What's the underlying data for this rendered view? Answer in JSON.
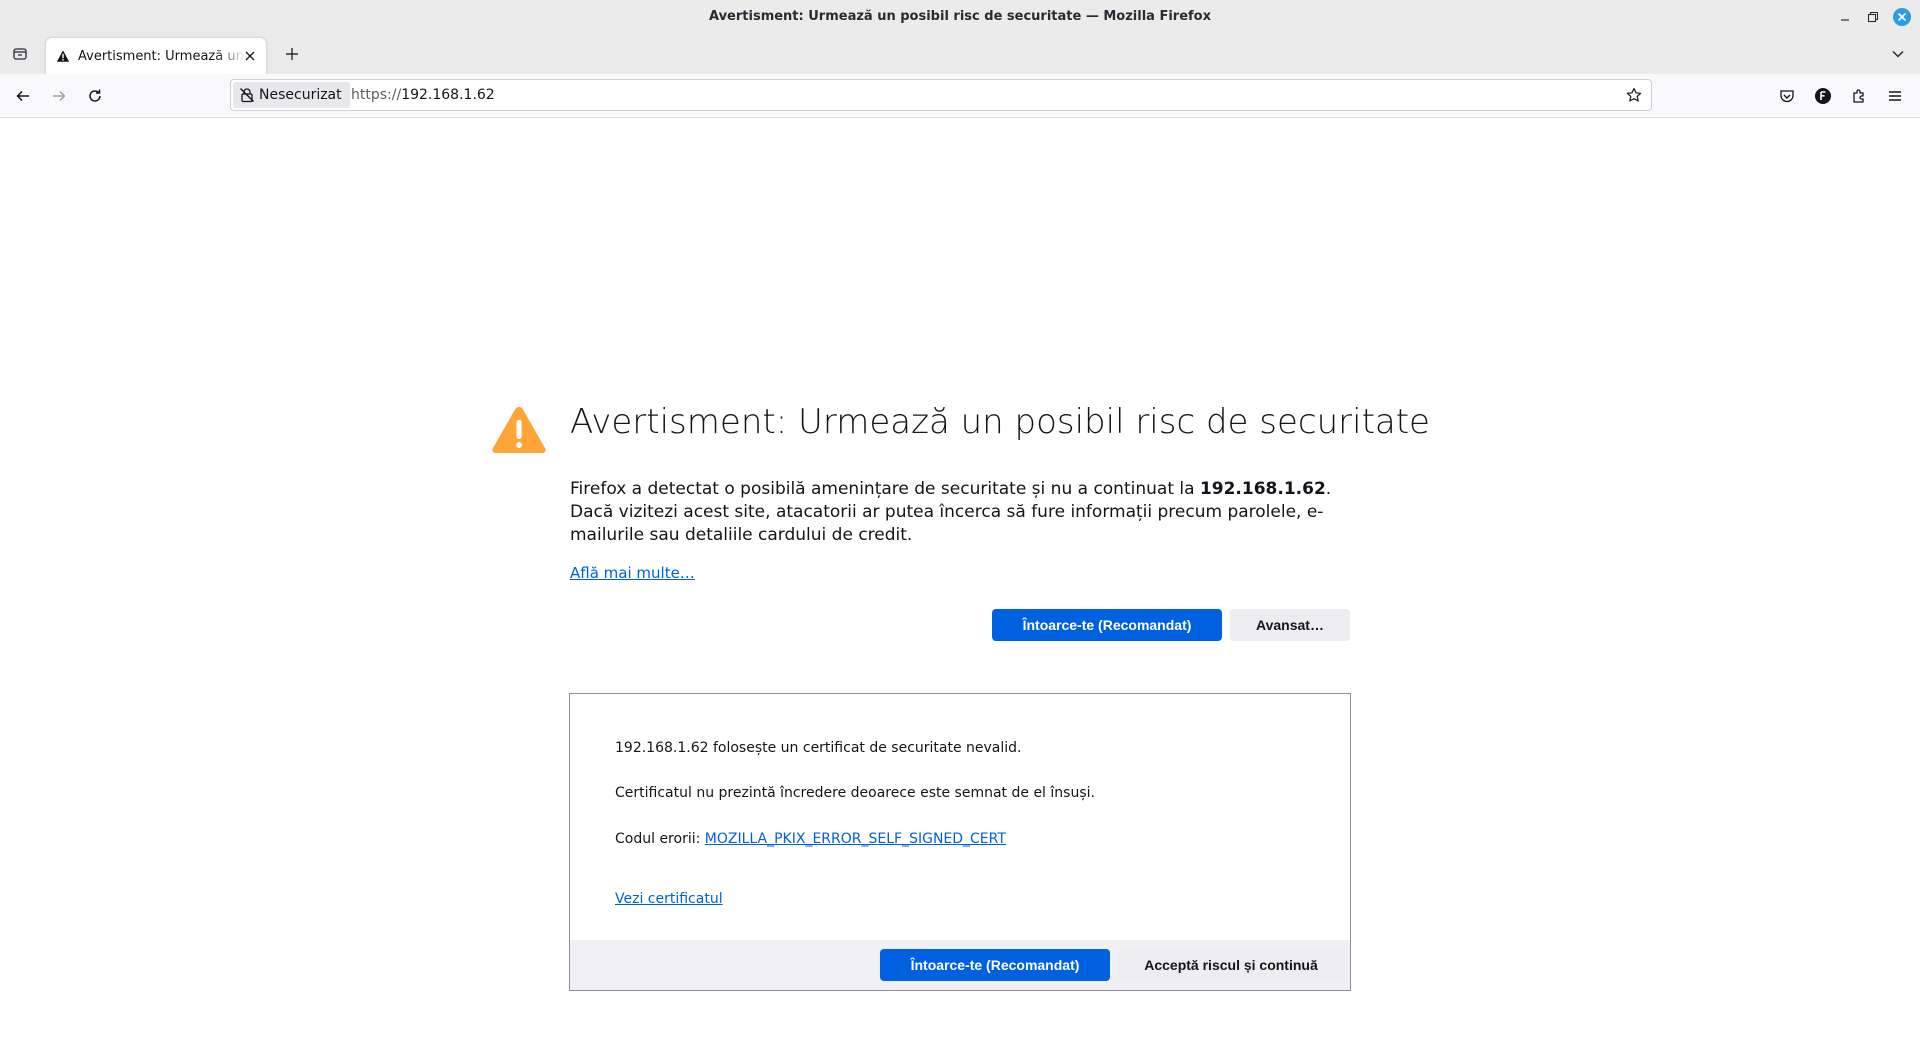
{
  "window": {
    "title": "Avertisment: Urmează un posibil risc de securitate — Mozilla Firefox",
    "controls": [
      "minimize-icon",
      "restore-icon",
      "close-icon"
    ],
    "close_color": "#2a9ee4"
  },
  "tabs": [
    {
      "title": "Avertisment: Urmează un posibil risc de securitate",
      "icon": "warning-icon",
      "active": true
    }
  ],
  "navbar": {
    "identity_label": "Nesecurizat",
    "url_scheme": "https://",
    "url_host": "192.168.1.62",
    "icons": [
      "back-icon",
      "forward-icon",
      "reload-icon",
      "lock-insecure-icon",
      "bookmark-star-icon",
      "pocket-icon",
      "account-icon",
      "extensions-icon",
      "menu-icon"
    ]
  },
  "error_page": {
    "title": "Avertisment: Urmează un posibil risc de securitate",
    "desc_part1": "Firefox a detectat o posibilă amenințare de securitate și nu a continuat la ",
    "desc_host": "192.168.1.62",
    "desc_part2": ". Dacă vizitezi acest site, atacatorii ar putea încerca să fure informații precum parolele, e-mailurile sau detaliile cardului de credit.",
    "learn_more": "Află mai multe…",
    "go_back_label": "Întoarce-te (Recomandat)",
    "advanced_label": "Avansat…",
    "warning_color": "#ffa436",
    "primary_color": "#0061e0"
  },
  "advanced_panel": {
    "line1": "192.168.1.62 folosește un certificat de securitate nevalid.",
    "line2": "Certificatul nu prezintă încredere deoarece este semnat de el însuși.",
    "error_code_label": "Codul erorii: ",
    "error_code": "MOZILLA_PKIX_ERROR_SELF_SIGNED_CERT",
    "view_certificate": "Vezi certificatul",
    "go_back_label": "Întoarce-te (Recomandat)",
    "accept_label": "Acceptă riscul și continuă"
  }
}
